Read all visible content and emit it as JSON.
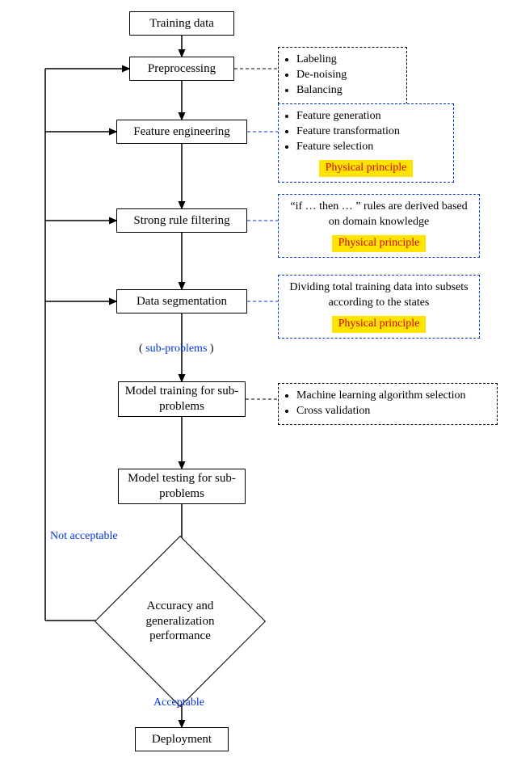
{
  "flow": {
    "start": "Training data",
    "preprocessing": "Preprocessing",
    "feature_eng": "Feature engineering",
    "strong_rule": "Strong rule filtering",
    "data_seg": "Data segmentation",
    "sub_problems_label": "sub-problems",
    "model_train": "Model training for sub-problems",
    "model_test": "Model testing for sub-problems",
    "decision": "Accuracy and generalization performance",
    "deploy": "Deployment"
  },
  "edges": {
    "not_acceptable": "Not acceptable",
    "acceptable": "Acceptable"
  },
  "notes": {
    "preprocessing": {
      "items": [
        "Labeling",
        "De-noising",
        "Balancing"
      ]
    },
    "feature_eng": {
      "items": [
        "Feature generation",
        "Feature transformation",
        "Feature selection"
      ],
      "principle": "Physical principle"
    },
    "strong_rule": {
      "text": "“if … then … ” rules are derived based on domain knowledge",
      "principle": "Physical principle"
    },
    "data_seg": {
      "text": "Dividing total training data into subsets according to the states",
      "principle": "Physical principle"
    },
    "model_train": {
      "items": [
        "Machine learning algorithm selection",
        "Cross validation"
      ]
    }
  }
}
